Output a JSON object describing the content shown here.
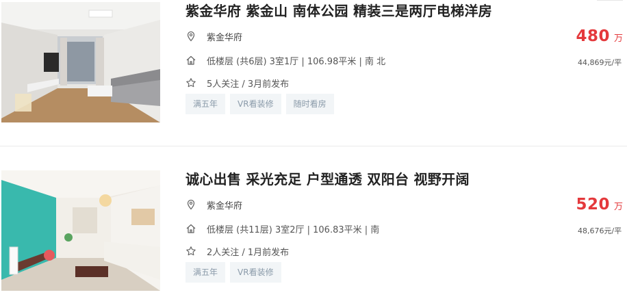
{
  "listings": [
    {
      "title": "紫金华府 紫金山 南体公园 精装三是两厅电梯洋房",
      "community": "紫金华府",
      "house_info": "低楼层 (共6层) 3室1厅 | 106.98平米 | 南 北",
      "follow_info": "5人关注 / 3月前发布",
      "tags": [
        "满五年",
        "VR看装修",
        "随时看房"
      ],
      "total_price": "480",
      "price_unit": "万",
      "unit_price": "44,869元/平"
    },
    {
      "title": "诚心出售 采光充足 户型通透 双阳台 视野开阔",
      "community": "紫金华府",
      "house_info": "低楼层 (共11层) 3室2厅 | 106.83平米 | 南",
      "follow_info": "2人关注 / 1月前发布",
      "tags": [
        "满五年",
        "VR看装修"
      ],
      "total_price": "520",
      "price_unit": "万",
      "unit_price": "48,676元/平"
    }
  ],
  "icons": {
    "community": "location-pin-icon",
    "house": "house-icon",
    "follow": "star-icon"
  },
  "colors": {
    "price": "#e4393c",
    "tag_bg": "#f2f5f7",
    "tag_text": "#8a9aa9",
    "title": "#222222"
  }
}
